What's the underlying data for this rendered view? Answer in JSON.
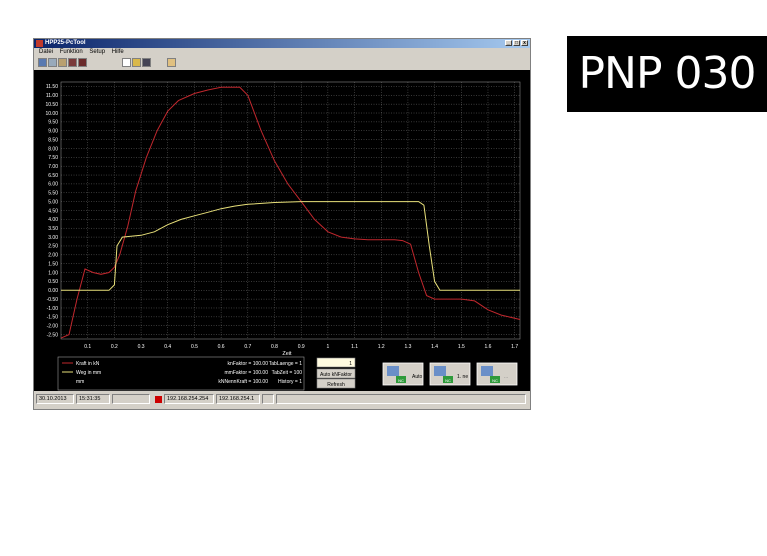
{
  "window": {
    "title": "HPP25-PcTool",
    "min": "_",
    "max": "□",
    "close": "x"
  },
  "menu": [
    "Datei",
    "Funktion",
    "Setup",
    "Hilfe"
  ],
  "toolbar_icons": [
    "chart-icon",
    "zoom-icon",
    "pen-icon",
    "screen-icon",
    "stop-icon",
    "new-file-icon",
    "open-folder-icon",
    "save-icon",
    "print-icon"
  ],
  "plot": {
    "y_ticks": [
      "11.50",
      "11.00",
      "10.50",
      "10.00",
      "9.50",
      "9.00",
      "8.50",
      "8.00",
      "7.50",
      "7.00",
      "6.50",
      "6.00",
      "5.50",
      "5.00",
      "4.50",
      "4.00",
      "3.50",
      "3.00",
      "2.50",
      "2.00",
      "1.50",
      "1.00",
      "0.50",
      "0.00",
      "-0.50",
      "-1.00",
      "-1.50",
      "-2.00",
      "-2.50"
    ],
    "x_ticks": [
      "0.1",
      "0.2",
      "0.3",
      "0.4",
      "0.5",
      "0.6",
      "0.7",
      "0.8",
      "0.9",
      "1",
      "1.1",
      "1.2",
      "1.3",
      "1.4",
      "1.5",
      "1.6",
      "1.7"
    ],
    "x_label": "Zeit"
  },
  "chart_data": {
    "type": "line",
    "xlabel": "Zeit",
    "ylabel": "",
    "xlim": [
      0,
      1.72
    ],
    "ylim": [
      -2.75,
      11.75
    ],
    "grid": true,
    "legend": "bottom-left",
    "series": [
      {
        "name": "Kraft in kN",
        "color": "#c0272d",
        "points": [
          [
            0,
            -2.7
          ],
          [
            0.03,
            -2.5
          ],
          [
            0.06,
            -0.5
          ],
          [
            0.09,
            1.2
          ],
          [
            0.12,
            1.0
          ],
          [
            0.15,
            0.9
          ],
          [
            0.18,
            1.0
          ],
          [
            0.2,
            1.3
          ],
          [
            0.22,
            2.0
          ],
          [
            0.25,
            3.6
          ],
          [
            0.28,
            5.6
          ],
          [
            0.32,
            7.5
          ],
          [
            0.36,
            9.0
          ],
          [
            0.4,
            10.1
          ],
          [
            0.44,
            10.7
          ],
          [
            0.5,
            11.1
          ],
          [
            0.55,
            11.3
          ],
          [
            0.6,
            11.45
          ],
          [
            0.67,
            11.45
          ],
          [
            0.7,
            11.0
          ],
          [
            0.75,
            9.0
          ],
          [
            0.8,
            7.3
          ],
          [
            0.85,
            6.0
          ],
          [
            0.9,
            5.0
          ],
          [
            0.95,
            4.0
          ],
          [
            1.0,
            3.3
          ],
          [
            1.05,
            3.0
          ],
          [
            1.1,
            2.9
          ],
          [
            1.15,
            2.85
          ],
          [
            1.2,
            2.85
          ],
          [
            1.25,
            2.85
          ],
          [
            1.28,
            2.8
          ],
          [
            1.31,
            2.6
          ],
          [
            1.34,
            1.0
          ],
          [
            1.37,
            -0.3
          ],
          [
            1.4,
            -0.5
          ],
          [
            1.5,
            -0.5
          ],
          [
            1.55,
            -0.6
          ],
          [
            1.6,
            -1.1
          ],
          [
            1.65,
            -1.4
          ],
          [
            1.72,
            -1.65
          ]
        ]
      },
      {
        "name": "Weg in mm",
        "color": "#e8e07a",
        "points": [
          [
            0,
            0
          ],
          [
            0.18,
            0
          ],
          [
            0.2,
            0.3
          ],
          [
            0.21,
            2.5
          ],
          [
            0.23,
            3.0
          ],
          [
            0.3,
            3.1
          ],
          [
            0.35,
            3.3
          ],
          [
            0.4,
            3.7
          ],
          [
            0.45,
            4.0
          ],
          [
            0.5,
            4.2
          ],
          [
            0.55,
            4.4
          ],
          [
            0.6,
            4.6
          ],
          [
            0.65,
            4.75
          ],
          [
            0.7,
            4.85
          ],
          [
            0.8,
            4.95
          ],
          [
            0.9,
            5.0
          ],
          [
            1.0,
            5.0
          ],
          [
            1.2,
            5.0
          ],
          [
            1.34,
            5.0
          ],
          [
            1.36,
            4.8
          ],
          [
            1.38,
            2.5
          ],
          [
            1.4,
            0.5
          ],
          [
            1.42,
            0
          ],
          [
            1.72,
            0
          ]
        ]
      }
    ]
  },
  "legend": {
    "items": [
      {
        "label": "Kraft in kN",
        "color": "#c0272d"
      },
      {
        "label": "Weg in mm",
        "color": "#e8e07a"
      },
      {
        "label": "mm",
        "color": ""
      }
    ],
    "factors": [
      "knFaktor = 100.00",
      "mmFaktor = 100.00",
      "kNNennKraft = 100.00"
    ],
    "tab": [
      "TabLaenge = 1",
      "TabZeit = 100",
      "History = 1"
    ]
  },
  "controls": {
    "input_value": "1",
    "auto_label": "Auto kNFaktor",
    "refresh_label": "Refresh"
  },
  "tool_buttons": [
    {
      "label": "Auto",
      "badge": "NC"
    },
    {
      "label": "1. ne",
      "badge": "NC"
    },
    {
      "label": "...",
      "badge": "NC"
    }
  ],
  "status": {
    "date": "30.10.2013",
    "time": "15:31:35",
    "ip1": "192.168.254.254",
    "ip2": "192.168.254.1"
  },
  "logo": "PNP 030"
}
